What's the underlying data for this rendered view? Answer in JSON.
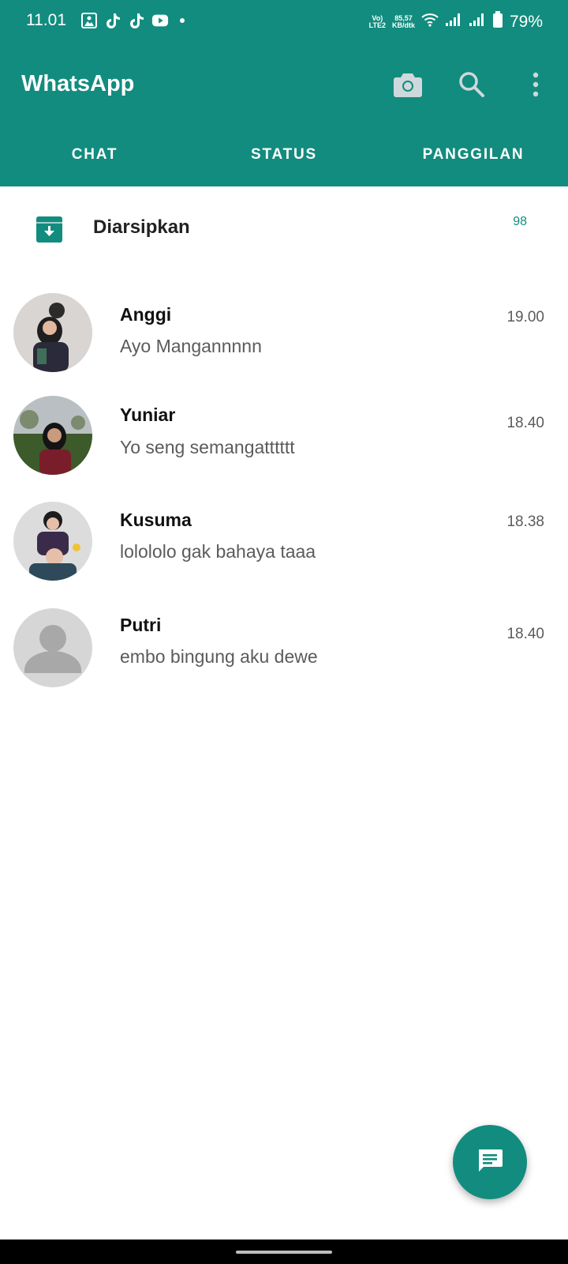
{
  "status_bar": {
    "time": "11.01",
    "network_line1": "Vo)",
    "network_line2": "LTE2",
    "speed_line1": "85,57",
    "speed_line2": "KB/dtk",
    "battery": "79%",
    "icons": [
      "gallery-icon",
      "tiktok-icon",
      "tiktok-icon",
      "youtube-icon",
      "dot-icon",
      "wifi-icon",
      "signal-icon",
      "signal-icon",
      "battery-icon"
    ]
  },
  "header": {
    "title": "WhatsApp",
    "icons": [
      "camera-icon",
      "search-icon",
      "more-vert-icon"
    ]
  },
  "tabs": [
    {
      "label": "CHAT"
    },
    {
      "label": "STATUS"
    },
    {
      "label": "PANGGILAN"
    }
  ],
  "archived": {
    "label": "Diarsipkan",
    "count": "98"
  },
  "chats": [
    {
      "name": "Anggi",
      "message": "Ayo Mangannnnn",
      "time": "19.00"
    },
    {
      "name": "Yuniar",
      "message": "Yo seng semangatttttt",
      "time": "18.40"
    },
    {
      "name": "Kusuma",
      "message": "lolololo gak bahaya taaa",
      "time": "18.38"
    },
    {
      "name": "Putri",
      "message": "embo bingung aku dewe",
      "time": "18.40"
    }
  ],
  "fab": {
    "icon": "new-chat-icon"
  },
  "colors": {
    "primary": "#128C7E",
    "accent": "#25D366",
    "text_primary": "#111111",
    "text_secondary": "#5b5b5b"
  }
}
